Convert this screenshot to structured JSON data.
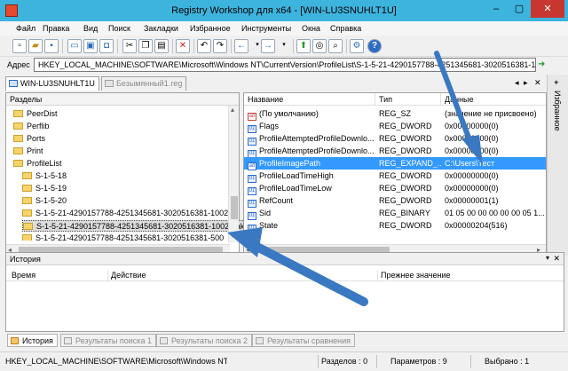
{
  "window": {
    "title": "Registry Workshop для x64 - [WIN-LU3SNUHLT1U]",
    "min": "–",
    "max": "▢",
    "close": "✕"
  },
  "menu": [
    "Файл",
    "Правка",
    "Вид",
    "Поиск",
    "Закладки",
    "Избранное",
    "Инструменты",
    "Окна",
    "Справка"
  ],
  "address": {
    "label": "Адрес",
    "value": "HKEY_LOCAL_MACHINE\\SOFTWARE\\Microsoft\\Windows NT\\CurrentVersion\\ProfileList\\S-1-5-21-4290157788-4251345681-3020516381-1002"
  },
  "tabs": [
    {
      "label": "WIN-LU3SNUHLT1U"
    },
    {
      "label": "Безымянный1.reg"
    }
  ],
  "favorites_label": "Избранное",
  "keys": {
    "header": "Разделы",
    "items": [
      {
        "label": "PeerDist",
        "level": 0
      },
      {
        "label": "Perflib",
        "level": 0
      },
      {
        "label": "Ports",
        "level": 0
      },
      {
        "label": "Print",
        "level": 0
      },
      {
        "label": "ProfileList",
        "level": 0
      },
      {
        "label": "S-1-5-18",
        "level": 1
      },
      {
        "label": "S-1-5-19",
        "level": 1
      },
      {
        "label": "S-1-5-20",
        "level": 1
      },
      {
        "label": "S-1-5-21-4290157788-4251345681-3020516381-1002",
        "level": 1
      },
      {
        "label": "S-1-5-21-4290157788-4251345681-3020516381-1002.bak",
        "level": 1,
        "selected": true
      },
      {
        "label": "S-1-5-21-4290157788-4251345681-3020516381-500",
        "level": 1
      }
    ]
  },
  "values": {
    "columns": [
      "Название",
      "Тип",
      "Данные"
    ],
    "rows": [
      {
        "name": "(По умолчанию)",
        "type": "REG_SZ",
        "data": "(значение не присвоено)",
        "icon": "ab"
      },
      {
        "name": "Flags",
        "type": "REG_DWORD",
        "data": "0x00000000(0)",
        "icon": "01"
      },
      {
        "name": "ProfileAttemptedProfileDownlo...",
        "type": "REG_DWORD",
        "data": "0x00000000(0)",
        "icon": "01"
      },
      {
        "name": "ProfileAttemptedProfileDownlo...",
        "type": "REG_DWORD",
        "data": "0x00000000(0)",
        "icon": "01"
      },
      {
        "name": "ProfileImagePath",
        "type": "REG_EXPAND_...",
        "data": "C:\\Users\\Тест",
        "icon": "ab",
        "selected": true
      },
      {
        "name": "ProfileLoadTimeHigh",
        "type": "REG_DWORD",
        "data": "0x00000000(0)",
        "icon": "01"
      },
      {
        "name": "ProfileLoadTimeLow",
        "type": "REG_DWORD",
        "data": "0x00000000(0)",
        "icon": "01"
      },
      {
        "name": "RefCount",
        "type": "REG_DWORD",
        "data": "0x00000001(1)",
        "icon": "01"
      },
      {
        "name": "Sid",
        "type": "REG_BINARY",
        "data": "01 05 00 00 00 00 00 05 1...",
        "icon": "01"
      },
      {
        "name": "State",
        "type": "REG_DWORD",
        "data": "0x00000204(516)",
        "icon": "01"
      }
    ]
  },
  "history": {
    "header": "История",
    "columns": [
      "Время",
      "Действие",
      "Прежнее значение"
    ]
  },
  "bottom_tabs": [
    "История",
    "Результаты поиска 1",
    "Результаты поиска 2",
    "Результаты сравнения"
  ],
  "status": {
    "path": "HKEY_LOCAL_MACHINE\\SOFTWARE\\Microsoft\\Windows NT\\Cu",
    "sections": "Разделов : 0",
    "params": "Параметров : 9",
    "selected": "Выбрано : 1"
  },
  "colors": {
    "titlebar": "#3db4de",
    "selection": "#3399ff",
    "arrow": "#3a78c2"
  }
}
